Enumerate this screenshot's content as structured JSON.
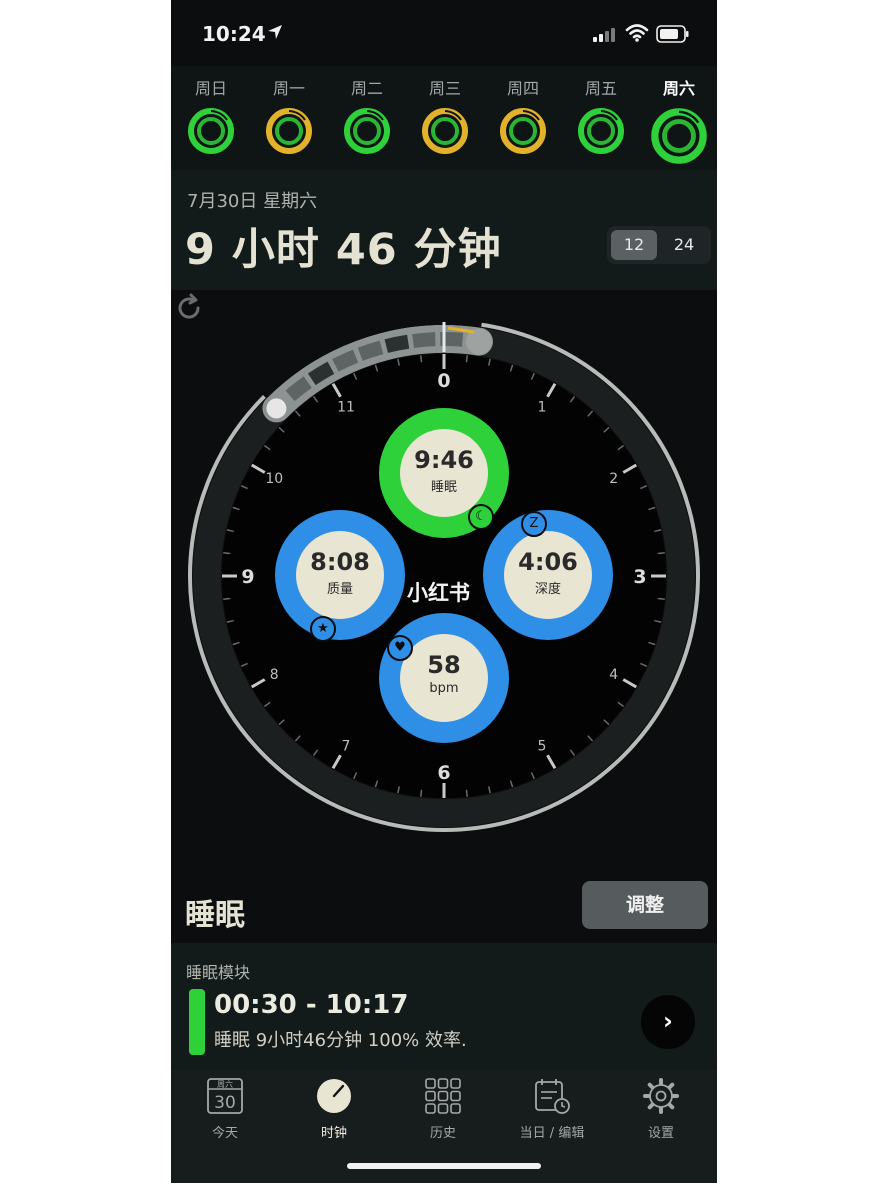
{
  "status_bar": {
    "time": "10:24"
  },
  "week": {
    "days": [
      {
        "label": "周日",
        "ring": "green"
      },
      {
        "label": "周一",
        "ring": "yellow"
      },
      {
        "label": "周二",
        "ring": "green"
      },
      {
        "label": "周三",
        "ring": "yellow"
      },
      {
        "label": "周四",
        "ring": "yellow"
      },
      {
        "label": "周五",
        "ring": "green"
      },
      {
        "label": "周六",
        "ring": "green"
      }
    ]
  },
  "header": {
    "date": "7月30日 星期六",
    "duration": "9 小时 46 分钟",
    "toggle": {
      "option_12": "12",
      "option_24": "24",
      "selected": "12"
    }
  },
  "dial": {
    "hours": [
      "0",
      "1",
      "2",
      "3",
      "4",
      "5",
      "6",
      "7",
      "8",
      "9",
      "10",
      "11"
    ],
    "sleep_start_hour": 10.5,
    "sleep_end_hour": 12.283,
    "metrics": {
      "sleep": {
        "value": "9:46",
        "label": "睡眠"
      },
      "quality": {
        "value": "8:08",
        "label": "质量"
      },
      "deep": {
        "value": "4:06",
        "label": "深度"
      },
      "heart": {
        "value": "58",
        "label": "bpm"
      }
    },
    "badge_deep_glyph": "Z",
    "watermark": "小红书"
  },
  "section": {
    "title": "睡眠",
    "adjust_label": "调整"
  },
  "module": {
    "heading": "睡眠模块",
    "time_range": "00:30 - 10:17",
    "description": "睡眠 9小时46分钟 100% 效率.",
    "arrow": "›"
  },
  "tabs": [
    {
      "label": "今天",
      "icon": "calendar-day-icon",
      "badge_top": "周六",
      "badge_num": "30"
    },
    {
      "label": "时钟",
      "icon": "clock-icon"
    },
    {
      "label": "历史",
      "icon": "grid-icon"
    },
    {
      "label": "当日 / 编辑",
      "icon": "calendar-edit-icon"
    },
    {
      "label": "设置",
      "icon": "gear-icon"
    }
  ],
  "colors": {
    "green": "#2fd13a",
    "yellow": "#e2b22b",
    "blue": "#2f8ee6",
    "cream": "#e9e5d3"
  }
}
